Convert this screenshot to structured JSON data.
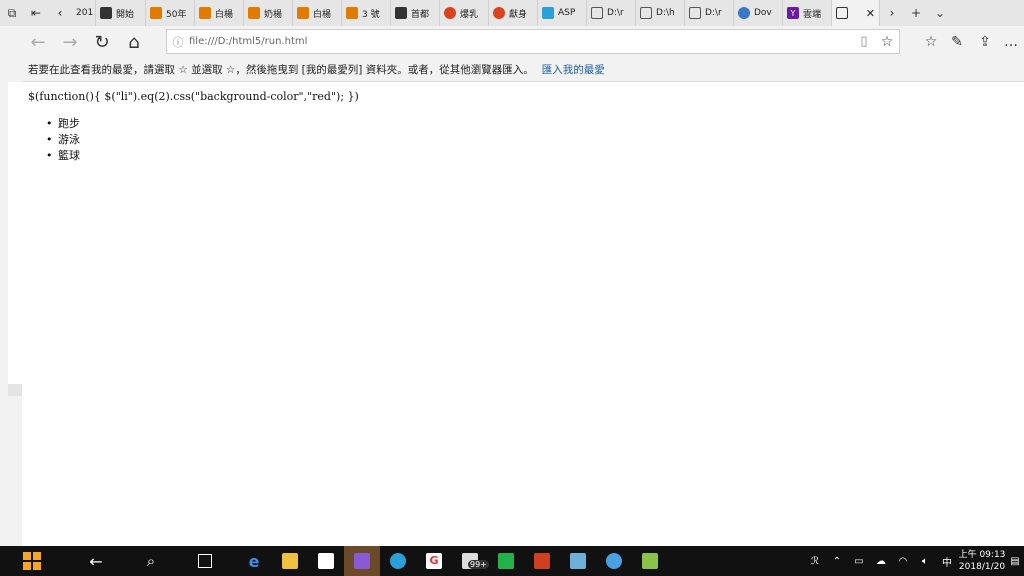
{
  "tabs": [
    {
      "label": "201",
      "icon": "back-arrow-icon",
      "color": "#e6e6e6"
    },
    {
      "label": "開始",
      "icon": "dark-box-icon",
      "color": "#333333"
    },
    {
      "label": "50年",
      "icon": "bookmark-icon",
      "color": "#e07b00"
    },
    {
      "label": "白楊",
      "icon": "bookmark-icon",
      "color": "#e07b00"
    },
    {
      "label": "奶楊",
      "icon": "bookmark-icon",
      "color": "#e07b00"
    },
    {
      "label": "白楊",
      "icon": "bookmark-icon",
      "color": "#e07b00"
    },
    {
      "label": "3 號",
      "icon": "bookmark-icon",
      "color": "#e07b00"
    },
    {
      "label": "首都",
      "icon": "dark-box-icon",
      "color": "#333333"
    },
    {
      "label": "爆乳",
      "icon": "circle-icon",
      "color": "#d9441e"
    },
    {
      "label": "獻身",
      "icon": "circle-icon",
      "color": "#d9441e"
    },
    {
      "label": "ASP",
      "icon": "asp-icon",
      "color": "#2aa0d8"
    },
    {
      "label": "D:\\r",
      "icon": "window-icon",
      "color": "#e6e6e6"
    },
    {
      "label": "D:\\h",
      "icon": "window-icon",
      "color": "#e6e6e6"
    },
    {
      "label": "D:\\r",
      "icon": "window-icon",
      "color": "#e6e6e6"
    },
    {
      "label": "Dov",
      "icon": "edge-icon",
      "color": "#3a78c8"
    },
    {
      "label": "雲端",
      "icon": "yahoo-icon",
      "color": "#6a1aa6"
    }
  ],
  "address": {
    "url": "file:///D:/html5/run.html"
  },
  "favbar": {
    "text": "若要在此查看我的最愛，請選取 ☆ 並選取 ☆，然後拖曳到 [我的最愛列] 資料夾。或者，從其他瀏覽器匯入。",
    "link": "匯入我的最愛"
  },
  "page": {
    "code": "$(function(){ $(\"li\").eq(2).css(\"background-color\",\"red\"); })",
    "items": [
      "跑步",
      "游泳",
      "籃球"
    ]
  },
  "taskbar": {
    "apps": [
      "start-icon",
      "back-arrow-icon",
      "search-icon",
      "task-view-icon",
      "edge-icon",
      "file-explorer-icon",
      "store-icon",
      "visual-studio-icon",
      "app-icon",
      "google-icon",
      "mail-icon",
      "line-icon",
      "app-icon",
      "app-icon",
      "app-icon",
      "notepad-icon"
    ],
    "badge": "99+",
    "clock_time": "上午 09:13",
    "clock_date": "2018/1/20",
    "ime": "中"
  }
}
